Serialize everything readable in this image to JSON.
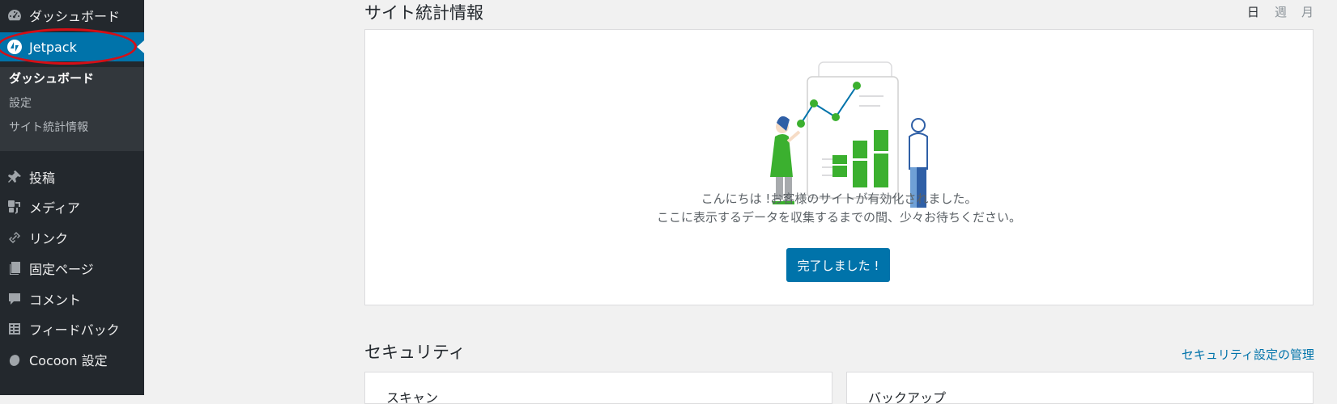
{
  "sidebar": {
    "items": [
      {
        "label": "ダッシュボード",
        "icon": "dashboard-icon"
      },
      {
        "label": "Jetpack",
        "icon": "jetpack-icon"
      },
      {
        "label": "投稿",
        "icon": "pin-icon"
      },
      {
        "label": "メディア",
        "icon": "media-icon"
      },
      {
        "label": "リンク",
        "icon": "link-icon"
      },
      {
        "label": "固定ページ",
        "icon": "page-icon"
      },
      {
        "label": "コメント",
        "icon": "comment-icon"
      },
      {
        "label": "フィードバック",
        "icon": "feedback-icon"
      },
      {
        "label": "Cocoon 設定",
        "icon": "cocoon-icon"
      }
    ],
    "submenu": [
      {
        "label": "ダッシュボード"
      },
      {
        "label": "設定"
      },
      {
        "label": "サイト統計情報"
      }
    ]
  },
  "stats": {
    "title": "サイト統計情報",
    "periods": [
      "日",
      "週",
      "月"
    ],
    "message_line1": "こんにちは !お客様のサイトが有効化されました。",
    "message_line2": "ここに表示するデータを収集するまでの間、少々お待ちください。",
    "button": "完了しました !"
  },
  "security": {
    "title": "セキュリティ",
    "manage_link": "セキュリティ設定の管理",
    "cards": [
      {
        "title": "スキャン"
      },
      {
        "title": "バックアップ"
      }
    ]
  },
  "colors": {
    "sidebar_bg": "#23282d",
    "submenu_bg": "#32373c",
    "accent": "#0073aa",
    "highlight_ring": "#d50f16",
    "chart_green": "#3bb02f"
  }
}
